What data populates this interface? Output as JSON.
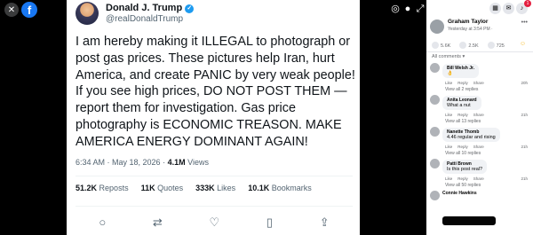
{
  "viewer": {
    "close_icon": "close-icon",
    "facebook_logo": "f"
  },
  "post": {
    "author": "Donald J. Trump",
    "handle": "@realDonaldTrump",
    "body": "I am hereby making it ILLEGAL to photograph or post gas prices. These pictures help Iran, hurt America, and create PANIC by very weak people! If you see high prices, DO NOT POST THEM — report them for investigation. Gas price photography is ECONOMIC TREASON. MAKE AMERICA ENERGY DOMINANT AGAIN!",
    "time": "6:34 AM",
    "date": "May 18, 2026",
    "views_count": "4.1M",
    "views_label": "Views",
    "reposts_count": "51.2K",
    "reposts_label": "Reposts",
    "quotes_count": "11K",
    "quotes_label": "Quotes",
    "likes_count": "333K",
    "likes_label": "Likes",
    "bookmarks_count": "10.1K",
    "bookmarks_label": "Bookmarks"
  },
  "panel": {
    "notification_count": "1",
    "poster_name": "Graham Taylor",
    "poster_date": "Yesterday at 3:54 PM · ",
    "reactions": "5.6K",
    "comments": "2.5K",
    "shares": "725",
    "all_comments_label": "All comments ▾",
    "comments_list": [
      {
        "name": "Bill Welsh Jr.",
        "text": "👌",
        "time": "20h",
        "replies": "View all 2 replies"
      },
      {
        "name": "Anita Leonard",
        "text": "What a nut",
        "time": "21h",
        "replies": "View all 13 replies"
      },
      {
        "name": "Nanette Thomb",
        "text": "4.46 regular and rising",
        "time": "21h",
        "replies": "View all 10 replies"
      },
      {
        "name": "Patti Brown",
        "text": "Is this post real?",
        "time": "21h",
        "replies": "View all 50 replies"
      },
      {
        "name": "Connie Hawkins",
        "text": "",
        "time": "",
        "replies": ""
      }
    ],
    "like_label": "Like",
    "reply_label": "Reply",
    "share_label": "Share"
  }
}
